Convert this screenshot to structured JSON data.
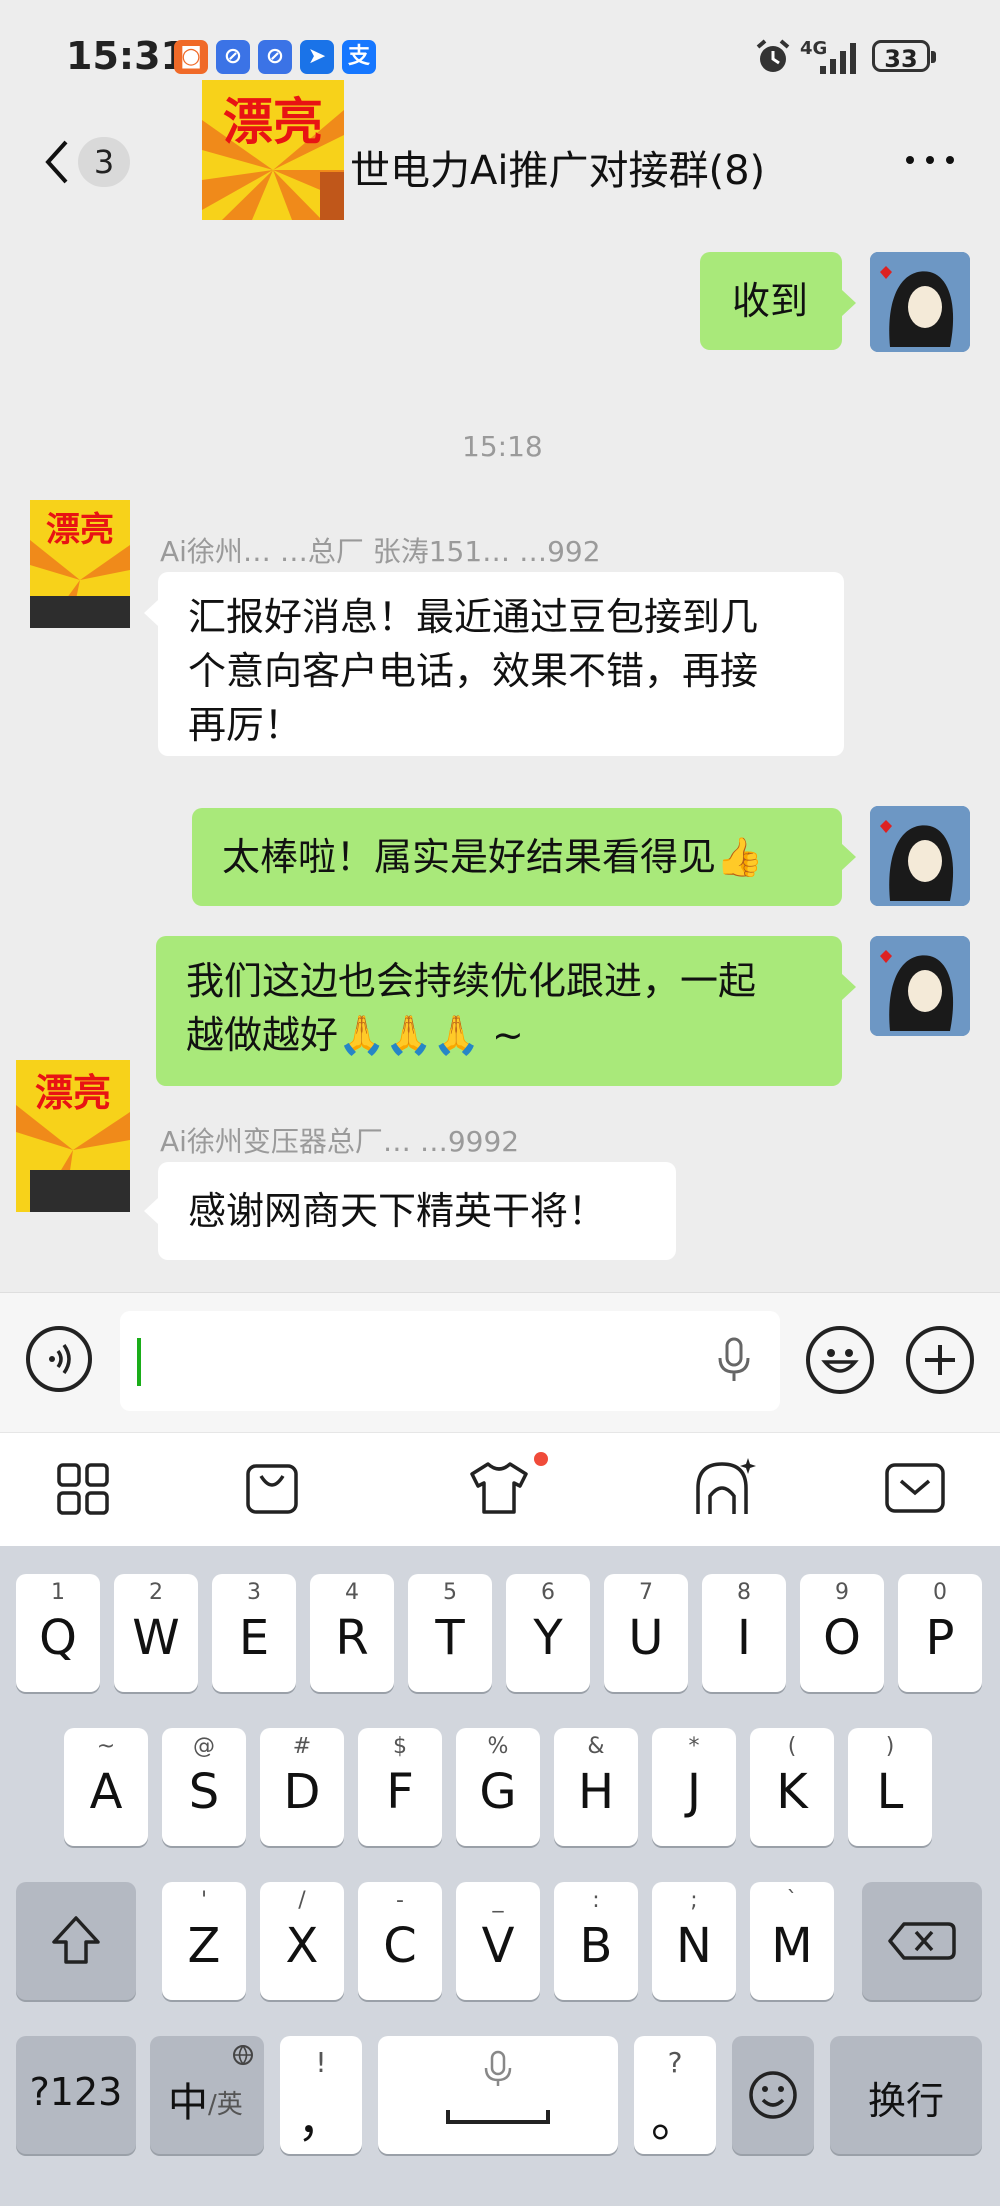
{
  "status_bar": {
    "time": "15:31",
    "network": "4G",
    "battery": "33",
    "app_icons": [
      "taobao-icon",
      "browser-icon",
      "browser-icon",
      "mail-icon",
      "alipay-icon"
    ],
    "alipay_glyph": "支"
  },
  "header": {
    "unread_count": "3",
    "title": "世电力Ai推广对接群(8)",
    "group_avatar_text": "漂亮"
  },
  "messages": [
    {
      "side": "me",
      "text": "收到"
    },
    {
      "timestamp": "15:18"
    },
    {
      "side": "other",
      "sender": "Ai徐州…  …总厂 张涛151…  …992",
      "avatar_text": "漂亮",
      "lines": [
        "汇报好消息！最近通过豆包接到几",
        "个意向客户电话，效果不错，再接",
        "再厉！"
      ]
    },
    {
      "side": "me",
      "text": "太棒啦！属实是好结果看得见👍"
    },
    {
      "side": "me",
      "lines": [
        "我们这边也会持续优化跟进，一起",
        "越做越好🙏🙏🙏 ~"
      ]
    },
    {
      "side": "other",
      "sender": "Ai徐州变压器总厂…  …9992",
      "avatar_text": "漂亮",
      "text": "感谢网商天下精英干将！"
    }
  ],
  "input": {
    "value": ""
  },
  "toolbar": [
    "apps-grid-icon",
    "shopping-bag-icon",
    "tshirt-icon",
    "ai-assistant-icon",
    "collapse-keyboard-icon"
  ],
  "keyboard": {
    "row1": [
      {
        "k": "Q",
        "s": "1"
      },
      {
        "k": "W",
        "s": "2"
      },
      {
        "k": "E",
        "s": "3"
      },
      {
        "k": "R",
        "s": "4"
      },
      {
        "k": "T",
        "s": "5"
      },
      {
        "k": "Y",
        "s": "6"
      },
      {
        "k": "U",
        "s": "7"
      },
      {
        "k": "I",
        "s": "8"
      },
      {
        "k": "O",
        "s": "9"
      },
      {
        "k": "P",
        "s": "0"
      }
    ],
    "row2": [
      {
        "k": "A",
        "s": "~"
      },
      {
        "k": "S",
        "s": "@"
      },
      {
        "k": "D",
        "s": "#"
      },
      {
        "k": "F",
        "s": "$"
      },
      {
        "k": "G",
        "s": "%"
      },
      {
        "k": "H",
        "s": "&"
      },
      {
        "k": "J",
        "s": "*"
      },
      {
        "k": "K",
        "s": "("
      },
      {
        "k": "L",
        "s": ")"
      }
    ],
    "row3": [
      {
        "k": "Z",
        "s": "'"
      },
      {
        "k": "X",
        "s": "/"
      },
      {
        "k": "C",
        "s": "-"
      },
      {
        "k": "V",
        "s": "_"
      },
      {
        "k": "B",
        "s": ":"
      },
      {
        "k": "N",
        "s": ";"
      },
      {
        "k": "M",
        "s": "`"
      }
    ],
    "num_key": "?123",
    "lang_key": "中",
    "lang_sub": "/英",
    "comma_key": "，",
    "comma_sub": "!",
    "period_key": "。",
    "period_sub": "?",
    "enter_key": "换行"
  }
}
